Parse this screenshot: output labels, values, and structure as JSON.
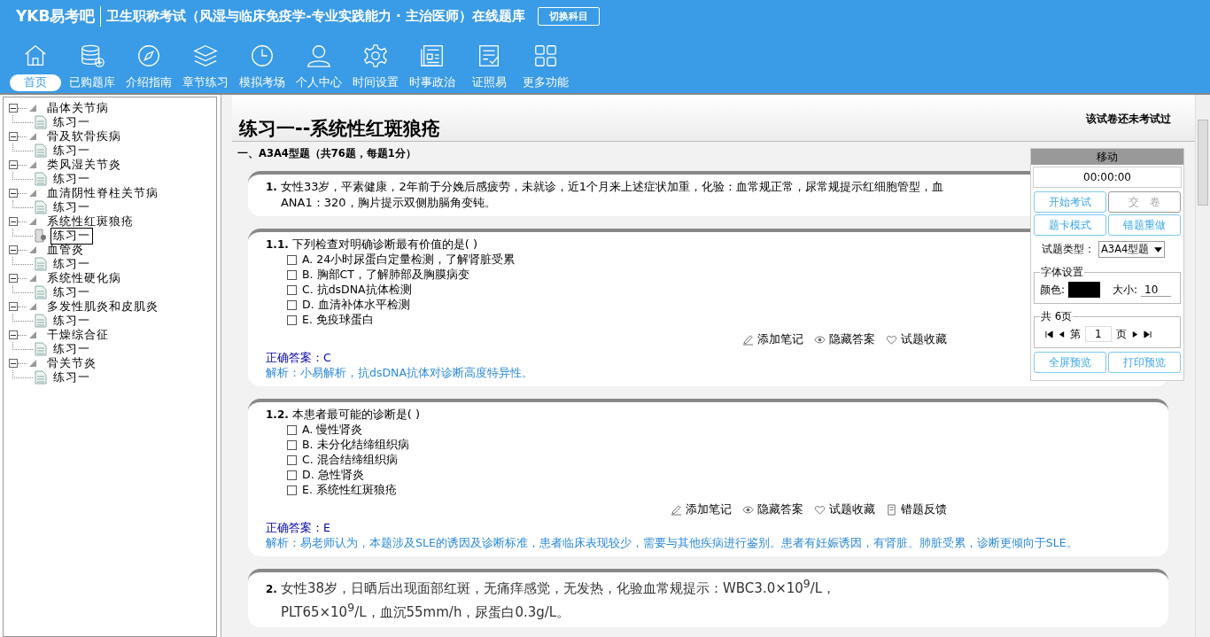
{
  "header": {
    "logo": "YKB易考吧",
    "title": "卫生职称考试（风湿与临床免疫学-专业实践能力 · 主治医师）在线题库",
    "switch_button": "切换科目"
  },
  "nav": [
    {
      "label": "首页",
      "selected": true
    },
    {
      "label": "已购题库",
      "selected": false
    },
    {
      "label": "介绍指南",
      "selected": false
    },
    {
      "label": "章节练习",
      "selected": false
    },
    {
      "label": "模拟考场",
      "selected": false
    },
    {
      "label": "个人中心",
      "selected": false
    },
    {
      "label": "时间设置",
      "selected": false
    },
    {
      "label": "时事政治",
      "selected": false
    },
    {
      "label": "证照易",
      "selected": false
    },
    {
      "label": "更多功能",
      "selected": false
    }
  ],
  "tree": [
    {
      "label": "晶体关节病",
      "expanded": true,
      "children": [
        {
          "label": "练习一",
          "selected": false
        }
      ]
    },
    {
      "label": "骨及软骨疾病",
      "expanded": true,
      "children": [
        {
          "label": "练习一",
          "selected": false
        }
      ]
    },
    {
      "label": "类风湿关节炎",
      "expanded": true,
      "children": [
        {
          "label": "练习一",
          "selected": false
        }
      ]
    },
    {
      "label": "血清阴性脊柱关节病",
      "expanded": true,
      "children": [
        {
          "label": "练习一",
          "selected": false
        }
      ]
    },
    {
      "label": "系统性红斑狼疮",
      "expanded": true,
      "children": [
        {
          "label": "练习一",
          "selected": true
        }
      ]
    },
    {
      "label": "血管炎",
      "expanded": true,
      "children": [
        {
          "label": "练习一",
          "selected": false
        }
      ]
    },
    {
      "label": "系统性硬化病",
      "expanded": true,
      "children": [
        {
          "label": "练习一",
          "selected": false
        }
      ]
    },
    {
      "label": "多发性肌炎和皮肌炎",
      "expanded": true,
      "children": [
        {
          "label": "练习一",
          "selected": false
        }
      ]
    },
    {
      "label": "干燥综合征",
      "expanded": true,
      "children": [
        {
          "label": "练习一",
          "selected": false
        }
      ]
    },
    {
      "label": "骨关节炎",
      "expanded": true,
      "children": [
        {
          "label": "练习一",
          "selected": false
        }
      ]
    }
  ],
  "paper": {
    "title": "练习一--系统性红斑狼疮",
    "status": "该试卷还未考试过",
    "section": "一、A3A4型题（共76题，每题1分）"
  },
  "questions": [
    {
      "kind": "stem",
      "number": "1.",
      "lines": [
        "女性33岁，平素健康，2年前于分娩后感疲劳，未就诊，近1个月来上述症状加重，化验：血常规正常，尿常规提示红细胞管型，血",
        "ANA1：320，胸片提示双侧肋膈角变钝。"
      ]
    },
    {
      "kind": "choice",
      "number": "1.1.",
      "text": "下列检查对明确诊断最有价值的是( )",
      "options": [
        {
          "text": "A. 24小时尿蛋白定量检测，了解肾脏受累",
          "checked": false
        },
        {
          "text": "B. 胸部CT，了解肺部及胸膜病变",
          "checked": false
        },
        {
          "text": "C. 抗dsDNA抗体检测",
          "checked": false
        },
        {
          "text": "D. 血清补体水平检测",
          "checked": false
        },
        {
          "text": "E. 免疫球蛋白",
          "checked": false
        }
      ],
      "actions": [
        "添加笔记",
        "隐藏答案",
        "试题收藏"
      ],
      "answer": "正确答案：C",
      "analysis": "解析：小易解析，抗dsDNA抗体对诊断高度特异性。"
    },
    {
      "kind": "choice",
      "number": "1.2.",
      "text": "本患者最可能的诊断是( )",
      "options": [
        {
          "text": "A. 慢性肾炎",
          "checked": false
        },
        {
          "text": "B. 未分化结缔组织病",
          "checked": false
        },
        {
          "text": "C. 混合结缔组织病",
          "checked": false
        },
        {
          "text": "D. 急性肾炎",
          "checked": false
        },
        {
          "text": "E. 系统性红斑狼疮",
          "checked": false
        }
      ],
      "actions": [
        "添加笔记",
        "隐藏答案",
        "试题收藏",
        "错题反馈"
      ],
      "answer": "正确答案：E",
      "analysis": "解析：易老师认为，本题涉及SLE的诱因及诊断标准，患者临床表现较少，需要与其他疾病进行鉴别。患者有妊娠诱因，有肾脏、肺脏受累，诊断更倾向于SLE。"
    },
    {
      "kind": "big",
      "number": "2.",
      "lines": [
        "女性38岁，日晒后出现面部红斑，无痛痒感觉，无发热，化验血常规提示：WBC3.0×10$^{9}$/L，",
        "PLT65×10$^{9}$/L，血沉55mm/h，尿蛋白0.3g/L。"
      ]
    }
  ],
  "panel": {
    "handle": "移动",
    "timer": "00:00:00",
    "buttons": [
      {
        "label": "开始考试",
        "disabled": false
      },
      {
        "label": "交　卷",
        "disabled": true
      },
      {
        "label": "题卡模式",
        "disabled": false
      },
      {
        "label": "错题重做",
        "disabled": false
      }
    ],
    "type_label": "试题类型：",
    "type_value": "A3A4型题",
    "font_group": "字体设置",
    "color_label": "颜色:",
    "color": "#000000",
    "size_label": "大小:",
    "size_value": "10",
    "pages_group": "共 6页",
    "page_prefix": "第",
    "page_value": "1",
    "page_suffix": "页",
    "bottom_buttons": [
      "全屏预览",
      "打印预览"
    ]
  }
}
